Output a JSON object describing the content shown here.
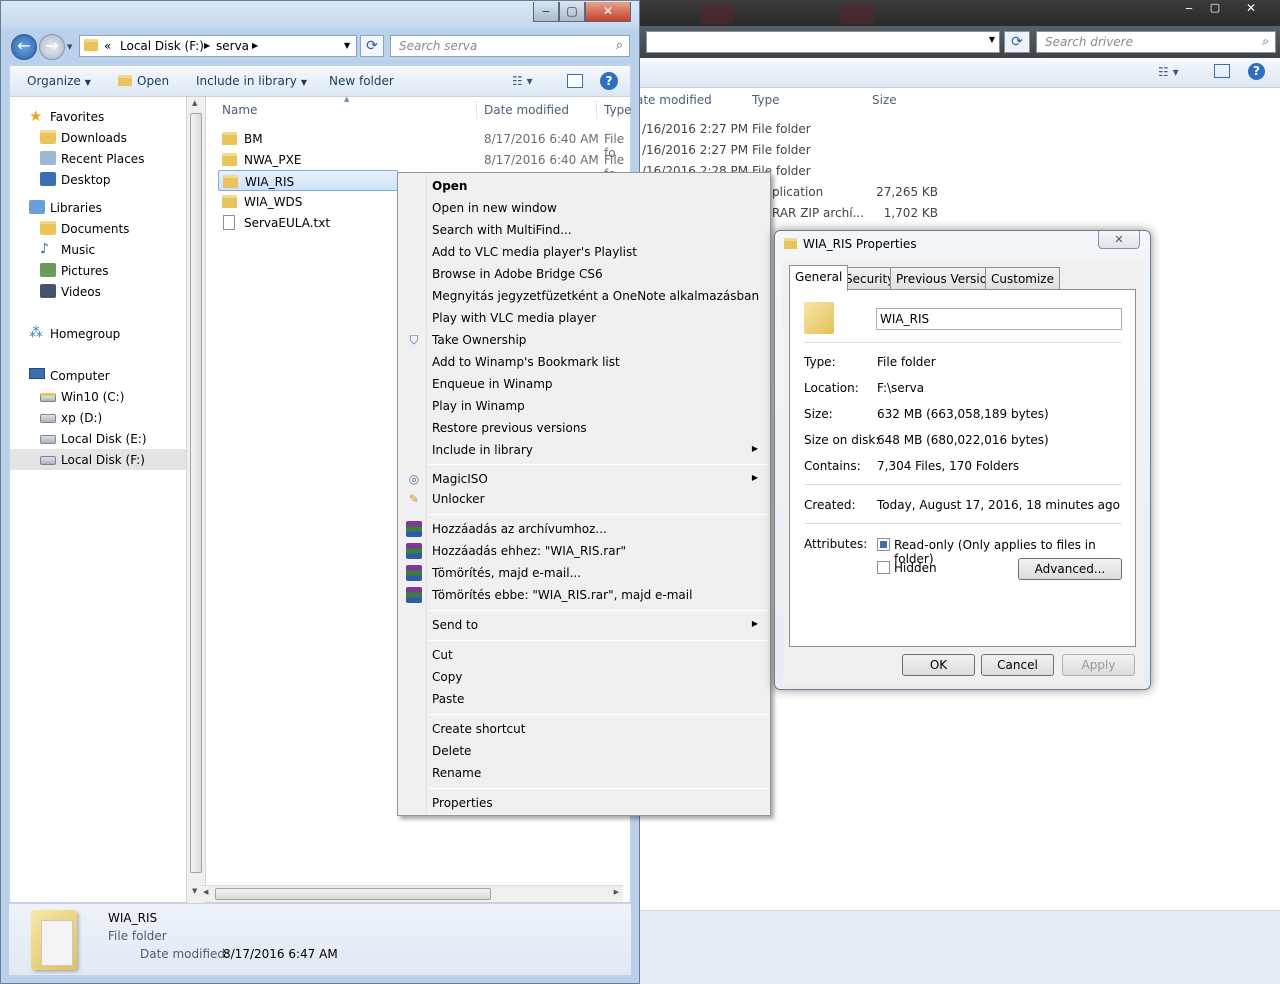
{
  "background_window": {
    "search_placeholder": "Search drivere",
    "columns": [
      "ate modified",
      "Type",
      "Size"
    ],
    "rows": [
      {
        "date": "/16/2016 2:27 PM",
        "type": "File folder",
        "size": ""
      },
      {
        "date": "/16/2016 2:27 PM",
        "type": "File folder",
        "size": ""
      },
      {
        "date": "/16/2016 2:28 PM",
        "type": "File folder",
        "size": ""
      },
      {
        "date": "",
        "type": "plication",
        "size": "27,265 KB"
      },
      {
        "date": "",
        "type": "RAR ZIP archí...",
        "size": "1,702 KB"
      }
    ]
  },
  "explorer": {
    "caption_buttons": {
      "minimize": "‒",
      "maximize": "▢",
      "close": "✕"
    },
    "breadcrumb": {
      "overflow": "«",
      "drive": "Local Disk (F:)",
      "folder": "serva"
    },
    "search_placeholder": "Search serva",
    "toolbar": {
      "organize": "Organize",
      "open": "Open",
      "include": "Include in library",
      "new_folder": "New folder"
    },
    "nav": {
      "favorites": "Favorites",
      "downloads": "Downloads",
      "recent": "Recent Places",
      "desktop": "Desktop",
      "libraries": "Libraries",
      "documents": "Documents",
      "music": "Music",
      "pictures": "Pictures",
      "videos": "Videos",
      "homegroup": "Homegroup",
      "computer": "Computer",
      "c": "Win10 (C:)",
      "d": "xp (D:)",
      "e": "Local Disk (E:)",
      "f": "Local Disk (F:)"
    },
    "columns": {
      "name": "Name",
      "date": "Date modified",
      "type": "Type"
    },
    "files": [
      {
        "name": "BM",
        "date": "8/17/2016 6:40 AM",
        "type": "File fo"
      },
      {
        "name": "NWA_PXE",
        "date": "8/17/2016 6:40 AM",
        "type": "File fo"
      },
      {
        "name": "WIA_RIS",
        "date": "",
        "type": ""
      },
      {
        "name": "WIA_WDS",
        "date": "",
        "type": ""
      },
      {
        "name": "ServaEULA.txt",
        "date": "",
        "type": ""
      }
    ],
    "details": {
      "name": "WIA_RIS",
      "type": "File folder",
      "date_label": "Date modified:",
      "date": "8/17/2016 6:47 AM"
    }
  },
  "context_menu": {
    "open": "Open",
    "open_new": "Open in new window",
    "multifind": "Search with MultiFind...",
    "vlc_playlist": "Add to VLC media player's Playlist",
    "bridge": "Browse in Adobe Bridge CS6",
    "onenote": "Megnyitás jegyzetfüzetként a OneNote alkalmazásban",
    "vlc_play": "Play with VLC media player",
    "ownership": "Take Ownership",
    "winamp_bookmark": "Add to Winamp's Bookmark list",
    "winamp_enqueue": "Enqueue in Winamp",
    "winamp_play": "Play in Winamp",
    "restore": "Restore previous versions",
    "include": "Include in library",
    "magiciso": "MagicISO",
    "unlocker": "Unlocker",
    "rar_add": "Hozzáadás az archívumhoz...",
    "rar_add_named": "Hozzáadás ehhez: \"WIA_RIS.rar\"",
    "rar_mail": "Tömörítés, majd e-mail...",
    "rar_mail_named": "Tömörítés ebbe: \"WIA_RIS.rar\", majd e-mail",
    "send_to": "Send to",
    "cut": "Cut",
    "copy": "Copy",
    "paste": "Paste",
    "create_shortcut": "Create shortcut",
    "delete": "Delete",
    "rename": "Rename",
    "properties": "Properties"
  },
  "properties_dialog": {
    "title": "WIA_RIS Properties",
    "tabs": [
      "General",
      "Security",
      "Previous Versions",
      "Customize"
    ],
    "name_value": "WIA_RIS",
    "fields": {
      "type_label": "Type:",
      "type": "File folder",
      "location_label": "Location:",
      "location": "F:\\serva",
      "size_label": "Size:",
      "size": "632 MB (663,058,189 bytes)",
      "disk_label": "Size on disk:",
      "disk": "648 MB (680,022,016 bytes)",
      "contains_label": "Contains:",
      "contains": "7,304 Files, 170 Folders",
      "created_label": "Created:",
      "created": "Today, August 17, 2016, 18 minutes ago",
      "attributes_label": "Attributes:"
    },
    "readonly_label": "Read-only (Only applies to files in folder)",
    "readonly_checked": true,
    "hidden_label": "Hidden",
    "hidden_checked": false,
    "advanced_label": "Advanced...",
    "ok_label": "OK",
    "cancel_label": "Cancel",
    "apply_label": "Apply"
  }
}
